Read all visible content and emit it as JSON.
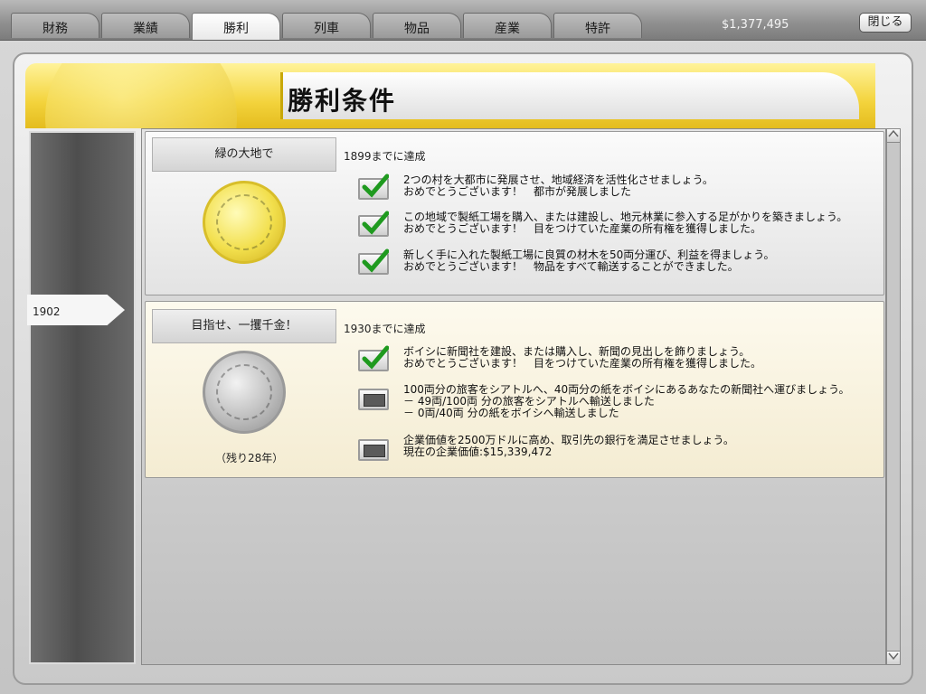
{
  "tabs": [
    {
      "label": "財務",
      "active": false
    },
    {
      "label": "業績",
      "active": false
    },
    {
      "label": "勝利",
      "active": true
    },
    {
      "label": "列車",
      "active": false
    },
    {
      "label": "物品",
      "active": false
    },
    {
      "label": "産業",
      "active": false
    },
    {
      "label": "特許",
      "active": false
    }
  ],
  "money": "$1,377,495",
  "close_label": "閉じる",
  "page_title": "勝利条件",
  "timeline": {
    "year": "1902"
  },
  "colors": {
    "gold": "#f3d33c",
    "check": "#1f9a1f"
  },
  "conditions": [
    {
      "name": "緑の大地で",
      "deadline": "1899までに達成",
      "medal": "gold",
      "objectives": [
        {
          "done": true,
          "line1": "2つの村を大都市に発展させ、地域経済を活性化させましょう。",
          "line2": "おめでとうございます！　都市が発展しました"
        },
        {
          "done": true,
          "line1": "この地域で製紙工場を購入、または建設し、地元林業に参入する足がかりを築きましょう。",
          "line2": "おめでとうございます！　目をつけていた産業の所有権を獲得しました。"
        },
        {
          "done": true,
          "line1": "新しく手に入れた製紙工場に良質の材木を50両分運び、利益を得ましょう。",
          "line2": "おめでとうございます！　物品をすべて輸送することができました。"
        }
      ]
    },
    {
      "name": "目指せ、一攫千金！",
      "deadline": "1930までに達成",
      "medal": "silver",
      "remaining": "（残り28年）",
      "objectives": [
        {
          "done": true,
          "line1": "ボイシに新聞社を建設、または購入し、新聞の見出しを飾りましょう。",
          "line2": "おめでとうございます！　目をつけていた産業の所有権を獲得しました。"
        },
        {
          "done": false,
          "line1": "100両分の旅客をシアトルへ、40両分の紙をボイシにあるあなたの新聞社へ運びましょう。",
          "line2": "－ 49両/100両 分の旅客をシアトルへ輸送しました",
          "line3": "－ 0両/40両 分の紙をボイシへ輸送しました"
        },
        {
          "done": false,
          "line1": "企業価値を2500万ドルに高め、取引先の銀行を満足させましょう。",
          "line2": "現在の企業価値:$15,339,472"
        }
      ]
    }
  ]
}
